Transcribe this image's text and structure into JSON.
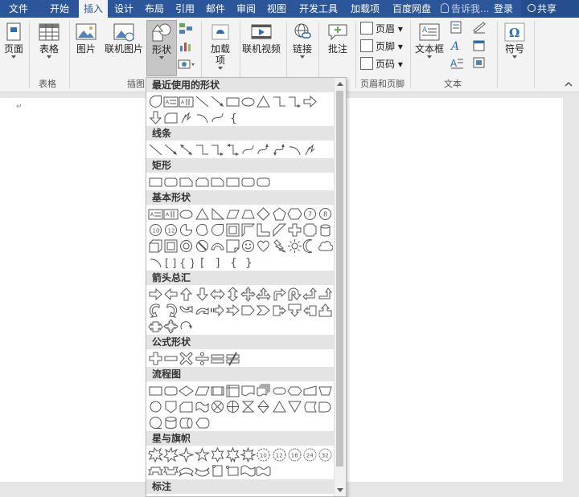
{
  "tabs": [
    {
      "label": "文件",
      "active": false
    },
    {
      "label": "开始",
      "active": false
    },
    {
      "label": "插入",
      "active": true
    },
    {
      "label": "设计",
      "active": false
    },
    {
      "label": "布局",
      "active": false
    },
    {
      "label": "引用",
      "active": false
    },
    {
      "label": "邮件",
      "active": false
    },
    {
      "label": "审阅",
      "active": false
    },
    {
      "label": "视图",
      "active": false
    },
    {
      "label": "开发工具",
      "active": false
    },
    {
      "label": "加载项",
      "active": false
    },
    {
      "label": "百度网盘",
      "active": false
    }
  ],
  "tell_me": "告诉我",
  "login": "登录",
  "share": "共享",
  "ribbon": {
    "page": "页面",
    "table": "表格",
    "picture": "图片",
    "online_picture": "联机图片",
    "shapes": "形状",
    "addin_1": "加载",
    "addin_2": "项",
    "online_video": "联机视频",
    "link": "链接",
    "comment": "批注",
    "header": "页眉",
    "footer": "页脚",
    "page_number": "页码",
    "textbox": "文本框",
    "symbol": "符号",
    "groups": {
      "table": "表格",
      "illustrations": "插图",
      "header_footer": "页眉和页脚",
      "text": "文本"
    }
  },
  "shapes_menu": {
    "categories": [
      {
        "key": "recent",
        "label": "最近使用的形状"
      },
      {
        "key": "lines",
        "label": "线条"
      },
      {
        "key": "rect",
        "label": "矩形"
      },
      {
        "key": "basic",
        "label": "基本形状"
      },
      {
        "key": "arrows",
        "label": "箭头总汇"
      },
      {
        "key": "equation",
        "label": "公式形状"
      },
      {
        "key": "flowchart",
        "label": "流程图"
      },
      {
        "key": "stars",
        "label": "星与旗帜"
      },
      {
        "key": "callouts",
        "label": "标注"
      }
    ]
  },
  "colors": {
    "brand": "#2b579a",
    "ribbon": "#f3f3f3",
    "category_band": "#e4e4e4"
  }
}
